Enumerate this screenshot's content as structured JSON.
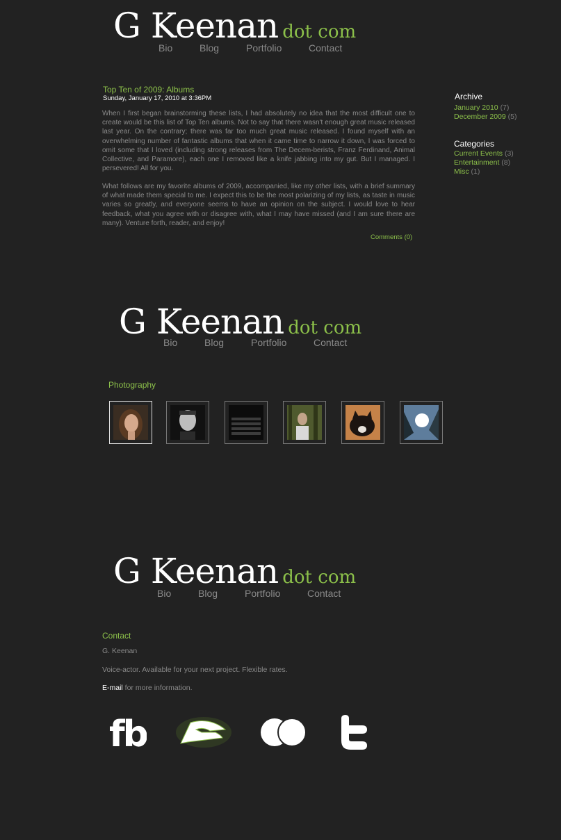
{
  "site": {
    "logo_name": "G Keenan",
    "logo_dot": "dot com",
    "nav": [
      "Bio",
      "Blog",
      "Portfolio",
      "Contact"
    ]
  },
  "blog": {
    "post": {
      "title": "Top Ten of 2009: Albums",
      "date": "Sunday, January 17, 2010 at 3:36PM",
      "paragraphs": [
        "When I first began brainstorming these lists, I had absolutely no idea that the most difficult one to create would be this list of Top Ten albums. Not to say that there wasn't enough great music released last year. On the contrary; there was far too much great music released. I found myself with an overwhelming number of fantastic albums that when it came time to narrow it down, I was forced to omit some that I loved (including strong releases from The Decem-berists, Franz Ferdinand, Animal Collective, and Paramore), each one I removed like a knife jabbing into my gut. But I managed. I persevered! All for you.",
        "What follows are my favorite albums of 2009, accompanied, like my other lists, with a brief summary of what made them special to me. I expect this to be the most polarizing of my lists, as taste in music varies so greatly, and everyone seems to have an opinion on the subject. I would love to hear feedback, what you agree with or disagree with, what I may have missed (and I am sure there are many). Venture forth, reader, and enjoy!"
      ],
      "comments": "Comments (0)"
    },
    "archive": {
      "heading": "Archive",
      "items": [
        {
          "label": "January 2010",
          "count": "(7)"
        },
        {
          "label": "December 2009",
          "count": "(5)"
        }
      ]
    },
    "categories": {
      "heading": "Categories",
      "items": [
        {
          "label": "Current Events",
          "count": "(3)"
        },
        {
          "label": "Entertainment",
          "count": "(8)"
        },
        {
          "label": "Misc",
          "count": "(1)"
        }
      ]
    }
  },
  "portfolio": {
    "heading": "Photography",
    "thumbs": [
      "portrait-woman",
      "portrait-man",
      "keyboard",
      "man-in-trees",
      "cat",
      "sunlight-trees"
    ]
  },
  "contact": {
    "heading": "Contact",
    "name": "G. Keenan",
    "tagline": "Voice-actor. Available for your next project. Flexible rates.",
    "email_link": "E-mail",
    "email_rest": " for more information.",
    "social": [
      "facebook-icon",
      "deviantart-icon",
      "flickr-icon",
      "twitter-icon"
    ]
  },
  "colors": {
    "background": "#222222",
    "accent": "#8cc04a",
    "text": "#8a8a8a",
    "heading": "#ffffff"
  }
}
